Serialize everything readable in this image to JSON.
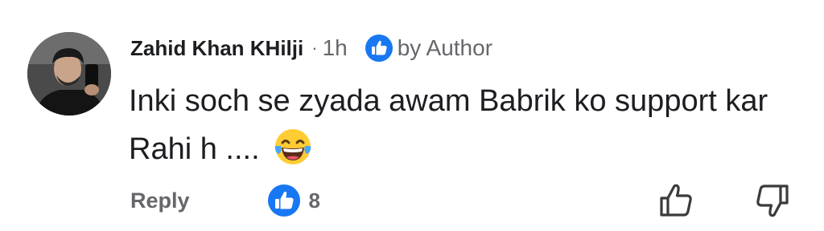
{
  "comment": {
    "author_name": "Zahid Khan KHilji",
    "separator": "·",
    "time": "1h",
    "badge_label": "by Author",
    "badge_icon": "thumbs-up-icon",
    "text": "Inki soch se zyada awam Babrik ko support kar Rahi h ....",
    "emoji": "laughing-tears-emoji",
    "reply_label": "Reply",
    "like_count": "8",
    "accent_color": "#1877f2"
  }
}
